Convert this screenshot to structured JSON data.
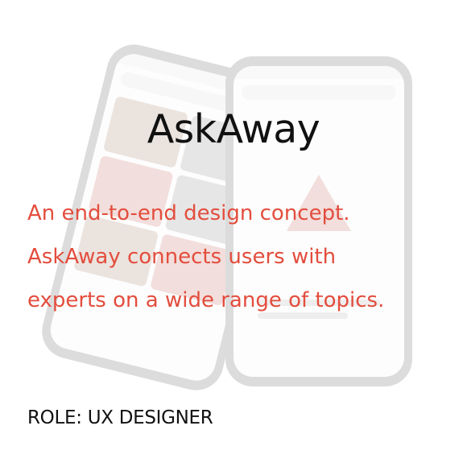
{
  "title": "AskAway",
  "description_lines": [
    "An end-to-end design concept.",
    "AskAway connects users with",
    "experts on a wide range of topics."
  ],
  "role": "ROLE: UX DESIGNER",
  "colors": {
    "background": "#ffffff",
    "title": "#111111",
    "accent": "#e34d3d",
    "role": "#111111"
  },
  "background_image": "faded-phone-mockups"
}
